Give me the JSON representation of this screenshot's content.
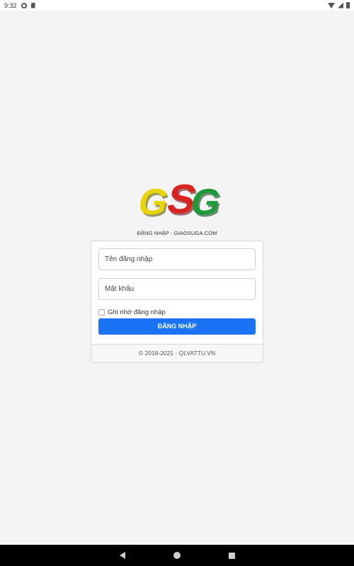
{
  "status_bar": {
    "time": "9:32",
    "icons": [
      "gear-icon",
      "sd-card-icon",
      "wifi-icon",
      "signal-icon",
      "battery-icon"
    ]
  },
  "logo": {
    "letters": [
      "G",
      "S",
      "G"
    ],
    "colors": {
      "g1": "#e8d400",
      "s": "#d9231f",
      "g2": "#1e9a3b"
    }
  },
  "login": {
    "caption": "ĐĂNG NHẬP - GIAOSUGA.COM",
    "username_placeholder": "Tên đăng nhập",
    "password_placeholder": "Mật khẩu",
    "remember_label": "Ghi nhớ đăng nhập",
    "submit_label": "ĐĂNG NHẬP",
    "footer": "© 2018-2021 - QLVATTU.VN"
  },
  "nav_bar": {
    "buttons": [
      "back-icon",
      "home-icon",
      "recent-apps-icon"
    ]
  },
  "colors": {
    "accent": "#1a73f5",
    "background": "#f4f4f4"
  }
}
